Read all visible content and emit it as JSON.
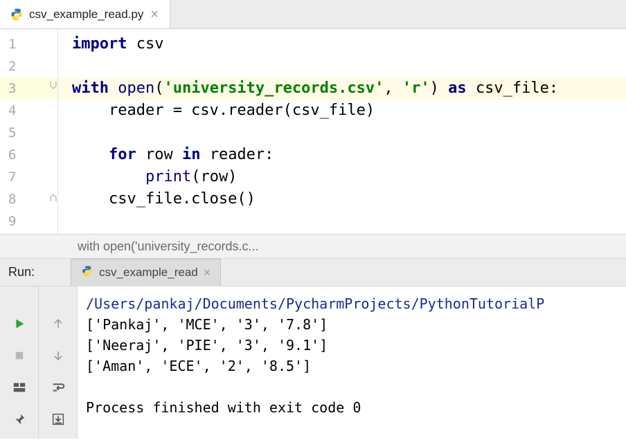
{
  "tab": {
    "filename": "csv_example_read.py"
  },
  "gutter": {
    "lines": [
      "1",
      "2",
      "3",
      "4",
      "5",
      "6",
      "7",
      "8",
      "9"
    ],
    "highlighted_line": 3
  },
  "code": {
    "l1_import": "import",
    "l1_csv": " csv",
    "l3_with": "with",
    "l3_open": " open",
    "l3_paren1": "(",
    "l3_str1": "'university_records.csv'",
    "l3_comma": ", ",
    "l3_str2": "'r'",
    "l3_paren2": ") ",
    "l3_as": "as",
    "l3_var": " csv_file:",
    "l4": "    reader = csv.reader(csv_file)",
    "l6_for": "    for",
    "l6_row": " row ",
    "l6_in": "in",
    "l6_reader": " reader:",
    "l7_indent": "        ",
    "l7_print": "print",
    "l7_arg": "(row)",
    "l8": "    csv_file.close()"
  },
  "breadcrumb": {
    "text": "with open('university_records.c..."
  },
  "run": {
    "title": "Run:",
    "tab": "csv_example_read",
    "out_path": "/Users/pankaj/Documents/PycharmProjects/PythonTutorialP",
    "out_rows": [
      "['Pankaj', 'MCE', '3', '7.8']",
      "['Neeraj', 'PIE', '3', '9.1']",
      "['Aman', 'ECE', '2', '8.5']"
    ],
    "out_exit": "Process finished with exit code 0"
  }
}
